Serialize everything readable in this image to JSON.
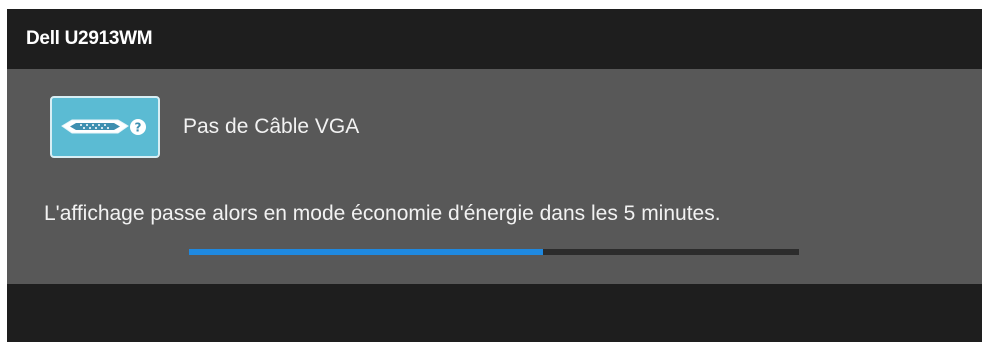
{
  "header": {
    "title": "Dell U2913WM"
  },
  "status": {
    "icon": "vga-cable-icon",
    "help_icon": "question-mark-icon",
    "message": "Pas de Câble VGA",
    "detail": "L'affichage passe alors en mode économie d'énergie dans les 5 minutes."
  },
  "progress": {
    "fraction": 0.58
  },
  "colors": {
    "accent": "#1f89e0",
    "tile": "#5bbbd3",
    "panel": "#585858",
    "chrome": "#1e1e1e"
  }
}
